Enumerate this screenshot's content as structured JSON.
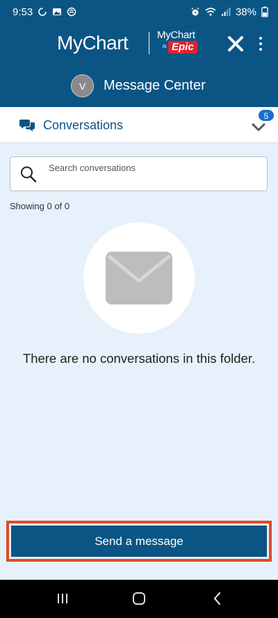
{
  "status_bar": {
    "time": "9:53",
    "battery": "38%",
    "left_icons": [
      "sync-icon",
      "image-icon",
      "shield-icon"
    ],
    "right_icons": [
      "alarm-icon",
      "wifi-icon",
      "signal-icon",
      "battery-icon"
    ]
  },
  "header": {
    "logo": "MyChart",
    "logo_secondary_top": "MyChart",
    "logo_secondary_is": "is",
    "logo_secondary_brand": "Epic",
    "avatar_initial": "V",
    "title": "Message Center"
  },
  "folder": {
    "label": "Conversations",
    "badge_count": "5"
  },
  "search": {
    "placeholder": "Search conversations",
    "value": ""
  },
  "results": {
    "showing_text": "Showing 0 of 0",
    "empty_message": "There are no conversations in this folder."
  },
  "actions": {
    "send_label": "Send a message"
  },
  "colors": {
    "header_bg": "#0b5584",
    "page_bg": "#e7f1fb",
    "badge": "#1a6fc9",
    "highlight_border": "#e04a28",
    "epic_red": "#e02430"
  }
}
